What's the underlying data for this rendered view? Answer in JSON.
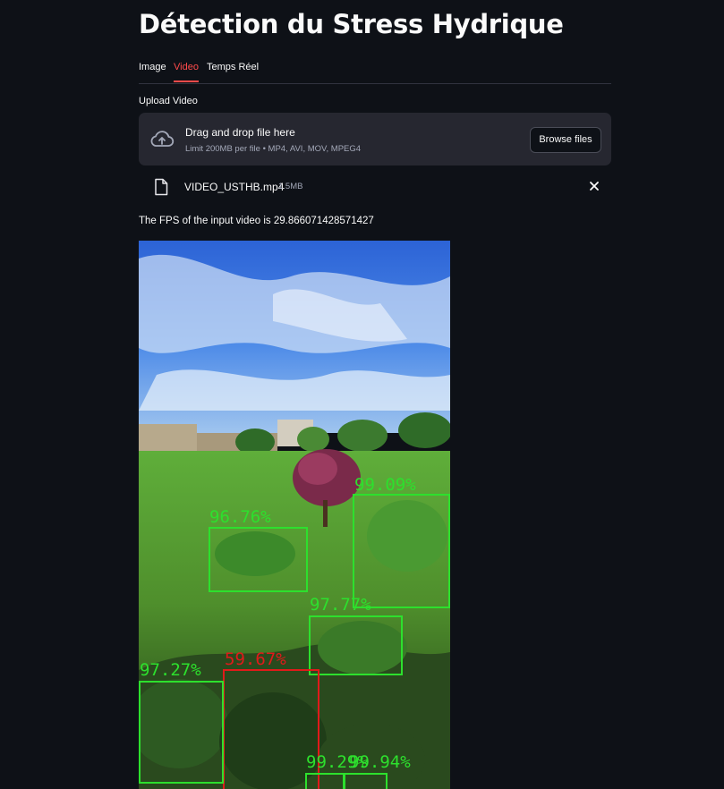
{
  "app": {
    "title": "Détection du Stress Hydrique"
  },
  "tabs": [
    {
      "label": "Image",
      "active": false
    },
    {
      "label": "Video",
      "active": true
    },
    {
      "label": "Temps Réel",
      "active": false
    }
  ],
  "uploader": {
    "label": "Upload Video",
    "drop_text": "Drag and drop file here",
    "limit_text": "Limit 200MB per file • MP4, AVI, MOV, MPEG4",
    "browse_label": "Browse files",
    "icon": "cloud-upload-icon"
  },
  "uploaded_file": {
    "name": "VIDEO_USTHB.mp4",
    "size": "1.5MB",
    "icon": "file-icon"
  },
  "fps_message": "The FPS of the input video is 29.866071428571427",
  "video": {
    "detections": [
      {
        "label": "99.09%",
        "color": "#2de02d"
      },
      {
        "label": "96.76%",
        "color": "#2de02d"
      },
      {
        "label": "97.77%",
        "color": "#2de02d"
      },
      {
        "label": "59.67%",
        "color": "#e01a1a"
      },
      {
        "label": "97.27%",
        "color": "#2de02d"
      },
      {
        "label": "99.29%",
        "color": "#2de02d"
      },
      {
        "label": "99.94%",
        "color": "#2de02d"
      }
    ]
  },
  "colors": {
    "background": "#0e1117",
    "accent": "#ff4b4b",
    "surface": "#262730"
  }
}
